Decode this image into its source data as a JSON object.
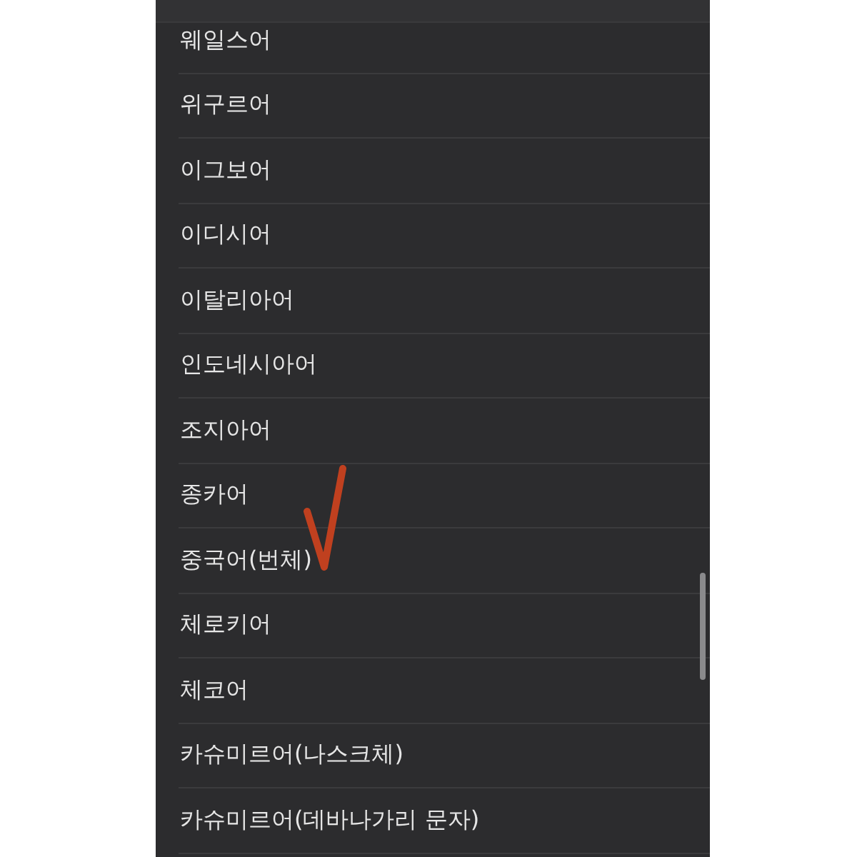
{
  "languages": [
    {
      "name": "웨일스어",
      "marked": false
    },
    {
      "name": "위구르어",
      "marked": false
    },
    {
      "name": "이그보어",
      "marked": false
    },
    {
      "name": "이디시어",
      "marked": false
    },
    {
      "name": "이탈리아어",
      "marked": false
    },
    {
      "name": "인도네시아어",
      "marked": false
    },
    {
      "name": "조지아어",
      "marked": false
    },
    {
      "name": "종카어",
      "marked": false
    },
    {
      "name": "중국어(번체)",
      "marked": true
    },
    {
      "name": "체로키어",
      "marked": false
    },
    {
      "name": "체코어",
      "marked": false
    },
    {
      "name": "카슈미르어(나스크체)",
      "marked": false
    },
    {
      "name": "카슈미르어(데바나가리 문자)",
      "marked": false
    }
  ]
}
